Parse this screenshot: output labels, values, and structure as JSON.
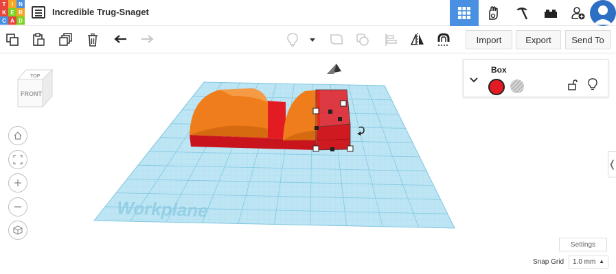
{
  "app": {
    "logo_letters": [
      "T",
      "I",
      "N",
      "K",
      "E",
      "R",
      "C",
      "A",
      "D"
    ],
    "logo_colors": [
      "#e8453c",
      "#f5a623",
      "#4a90e2",
      "#e8453c",
      "#7ed321",
      "#f5a623",
      "#4a90e2",
      "#e8453c",
      "#7ed321"
    ],
    "title": "Incredible Trug-Snaget",
    "accent": "#4a90e2"
  },
  "top_nav": {
    "items": [
      {
        "icon": "grid-3d-view-icon",
        "active": true
      },
      {
        "icon": "blocks-hand-icon",
        "active": false
      },
      {
        "icon": "pickaxe-icon",
        "active": false
      },
      {
        "icon": "bricks-icon",
        "active": false
      },
      {
        "icon": "add-user-icon",
        "active": false
      },
      {
        "icon": "user-avatar-icon",
        "active": false
      }
    ]
  },
  "toolbar": {
    "import_label": "Import",
    "export_label": "Export",
    "sendto_label": "Send To"
  },
  "workplane": {
    "label": "Workplane",
    "grid_color": "#9fd6ec",
    "shape_colors": {
      "box": "#e31b23",
      "roof": "#f07d1b"
    }
  },
  "viewcube": {
    "top": "TOP",
    "front": "FRONT"
  },
  "shape_panel": {
    "title": "Box",
    "solid_color": "#e31b23",
    "hole_label": "hole-swatch"
  },
  "footer": {
    "settings_label": "Settings",
    "snap_label": "Snap Grid",
    "snap_value": "1.0 mm"
  }
}
